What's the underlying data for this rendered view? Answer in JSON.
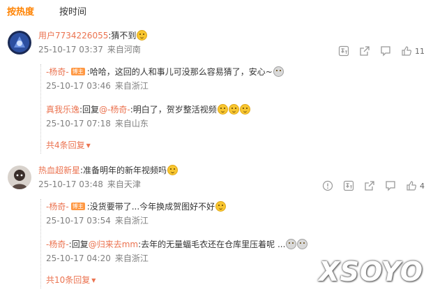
{
  "tabs": [
    {
      "label": "按热度",
      "active": true
    },
    {
      "label": "按时间",
      "active": false
    }
  ],
  "comments": [
    {
      "username": "用户7734226055",
      "text": ":猜不到",
      "emoji": "sweat-emoji",
      "time": "25-10-17 03:37",
      "location": "来自河南",
      "likes": "11",
      "replies": [
        {
          "username": "-杨奇-",
          "badge": "博主",
          "text": ":哈哈，这回的人和事儿可没那么容易猜了，安心~",
          "emoji": "panda-emoji",
          "time": "25-10-17 03:46",
          "location": "来自浙江"
        },
        {
          "username": "真我乐逸",
          "reply_prefix": ":回复",
          "reply_to": "@-杨奇-",
          "text": ":明白了，贺岁整活视频",
          "emoji": "grin-emoji x3",
          "time": "25-10-17 07:18",
          "location": "来自山东"
        }
      ],
      "more": "共4条回复"
    },
    {
      "username": "热血超新星",
      "text": ":准备明年的新年视频吗",
      "emoji": "party-emoji",
      "time": "25-10-17 03:48",
      "location": "来自天津",
      "likes": "4",
      "replies": [
        {
          "username": "-杨奇-",
          "badge": "博主",
          "text": ":没货要带了...今年换成贺图好不好",
          "emoji": "sad-emoji",
          "time": "25-10-17 03:54",
          "location": "来自浙江"
        },
        {
          "username": "-杨奇-",
          "reply_prefix": ":回复",
          "reply_to": "@归来去mm",
          "text": ":去年的无量蝠毛衣还在仓库里压着呢 ...",
          "emoji": "cry-emoji x2",
          "time": "25-10-17 04:20",
          "location": "来自浙江"
        }
      ],
      "more": "共10条回复"
    }
  ],
  "watermark": "XSOYO",
  "colors": {
    "accent": "#ff8200",
    "username": "#eb7350",
    "meta": "#808080",
    "badge": "#ff9843"
  }
}
